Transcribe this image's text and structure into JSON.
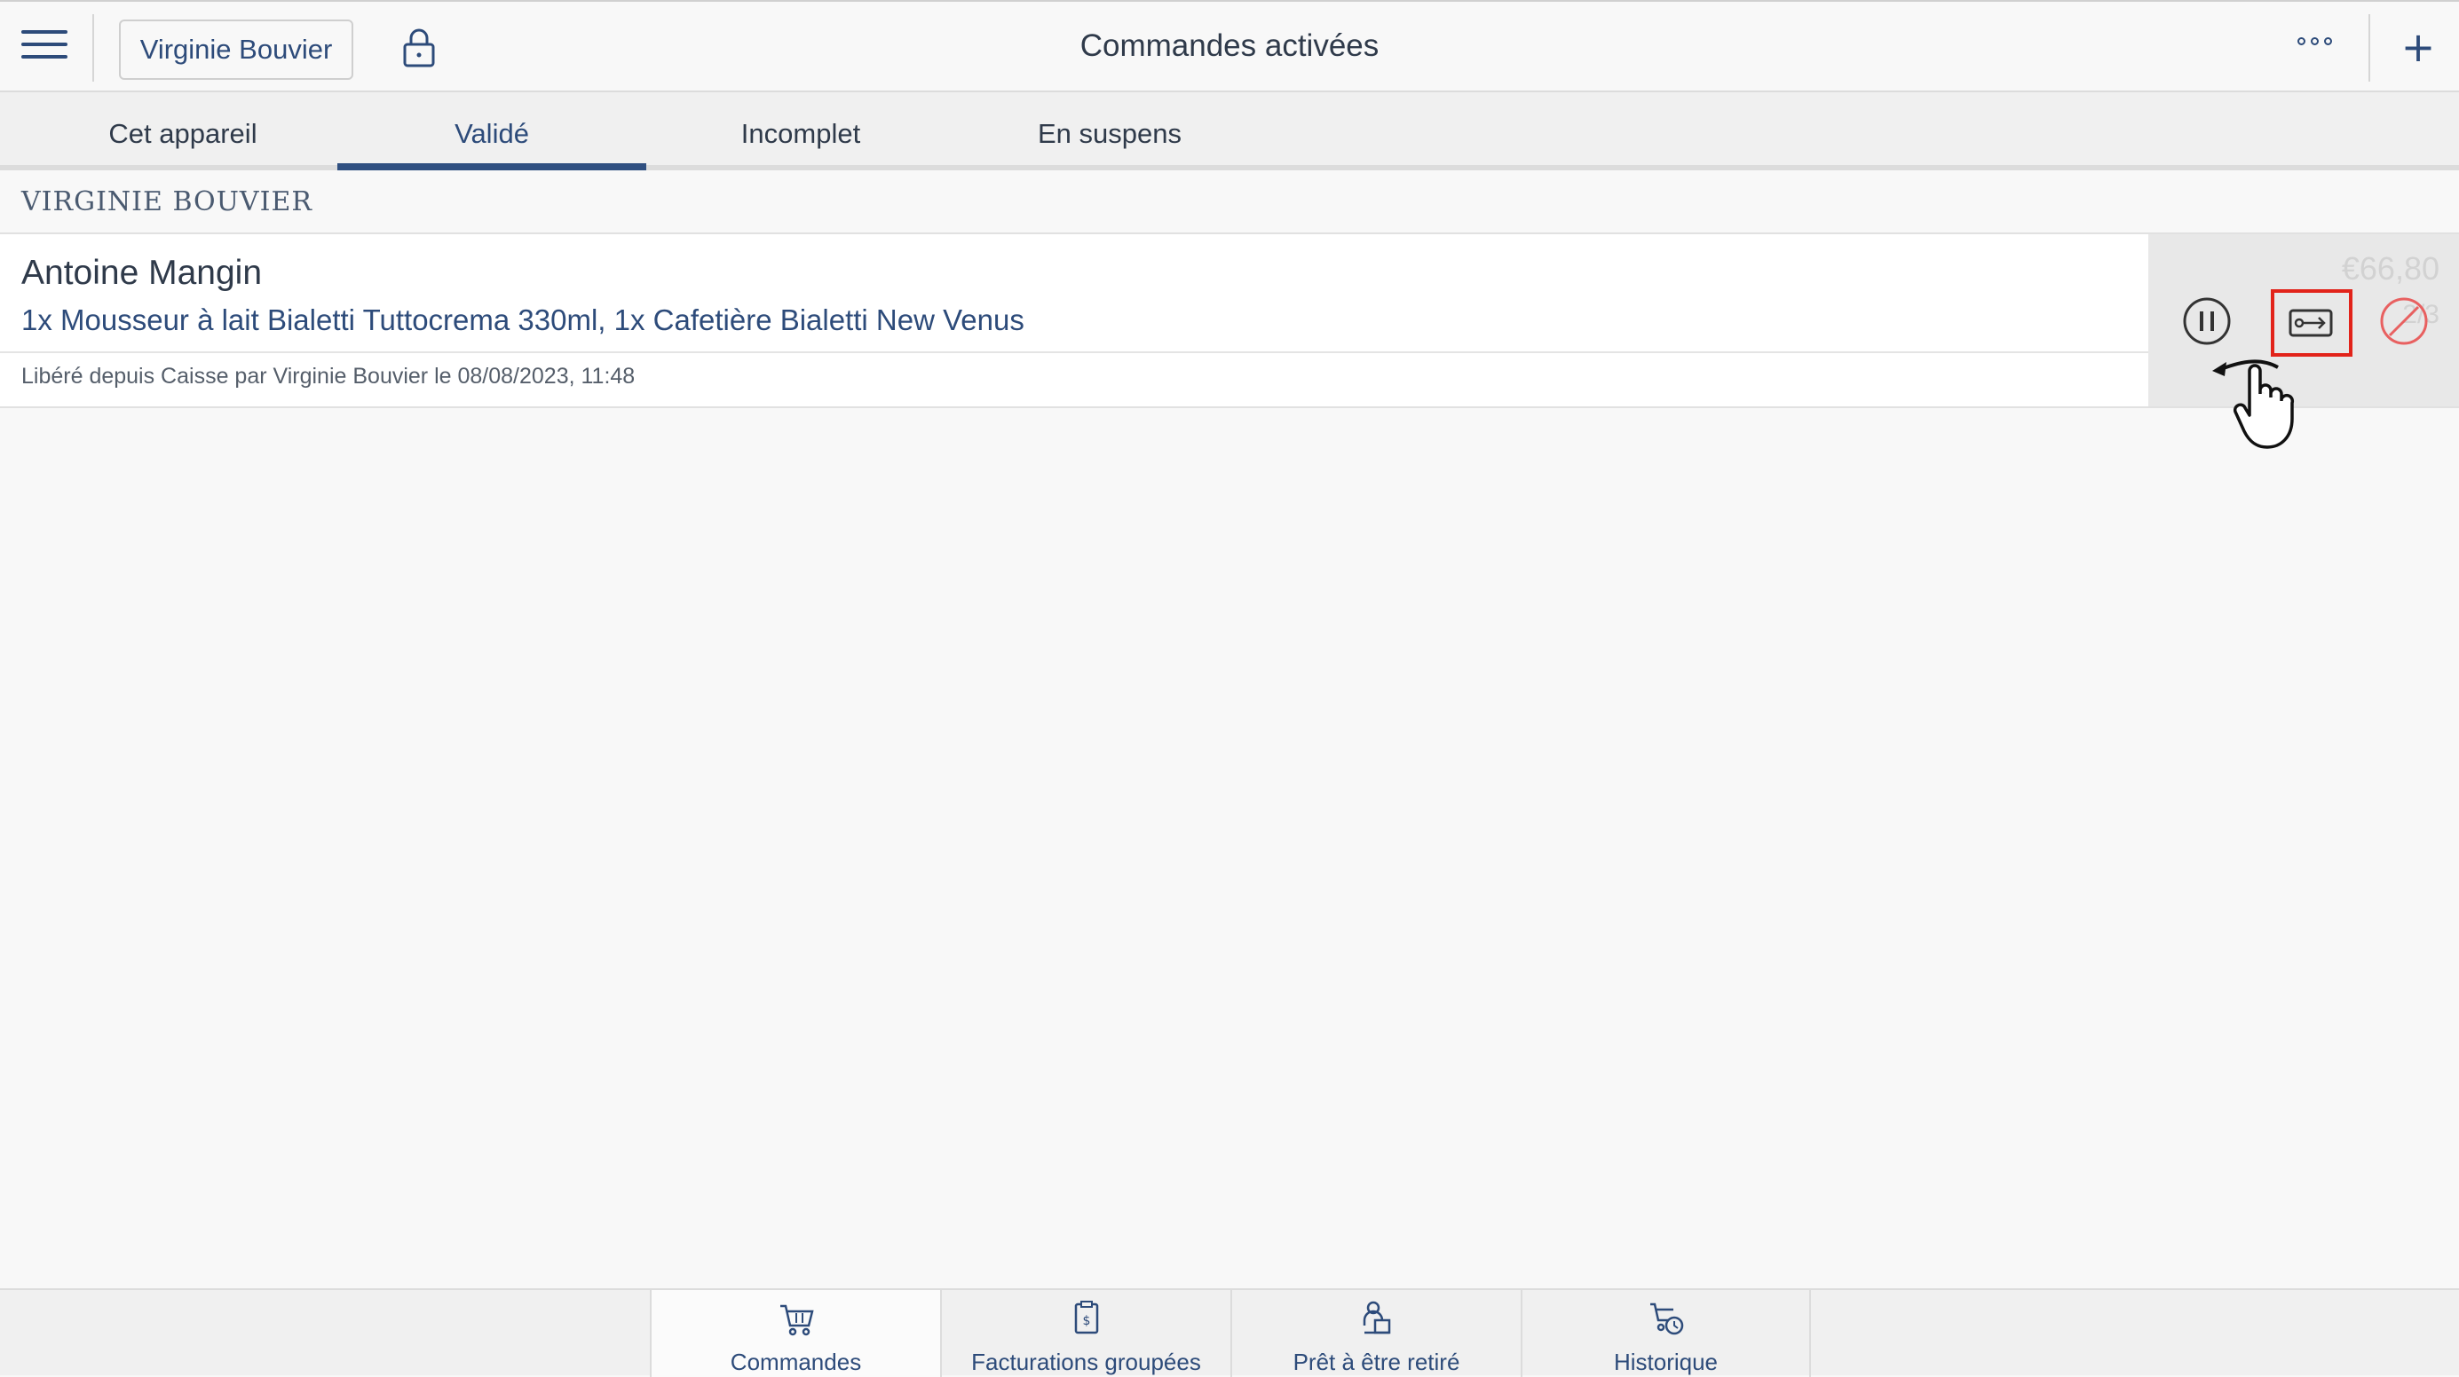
{
  "header": {
    "user_button_label": "Virginie Bouvier",
    "title": "Commandes activées",
    "icons": [
      "hamburger-menu-icon",
      "lock-icon",
      "more-options-icon",
      "plus-icon"
    ]
  },
  "tabs": [
    {
      "label": "Cet appareil",
      "active": false
    },
    {
      "label": "Validé",
      "active": true
    },
    {
      "label": "Incomplet",
      "active": false
    },
    {
      "label": "En suspens",
      "active": false
    }
  ],
  "section": {
    "header": "VIRGINIE BOUVIER"
  },
  "order": {
    "customer": "Antoine Mangin",
    "items": "1x Mousseur à lait Bialetti Tuttocrema 330ml, 1x Cafetière Bialetti New Venus",
    "meta": "Libéré depuis Caisse par Virginie Bouvier le 08/08/2023, 11:48",
    "price_partially_hidden": "€66,80",
    "count_partially_hidden": "2/3",
    "actions": [
      "pause-icon",
      "release-icon",
      "cancel-icon"
    ]
  },
  "bottom_nav": [
    {
      "label": "Commandes",
      "icon": "cart-icon",
      "active": true
    },
    {
      "label": "Facturations groupées",
      "icon": "invoice-icon",
      "active": false
    },
    {
      "label": "Prêt à être retiré",
      "icon": "pickup-icon",
      "active": false
    },
    {
      "label": "Historique",
      "icon": "cart-history-icon",
      "active": false
    }
  ],
  "colors": {
    "accent": "#2d4b7a",
    "highlight_box": "#e2231a",
    "cancel_icon": "#e86060"
  }
}
